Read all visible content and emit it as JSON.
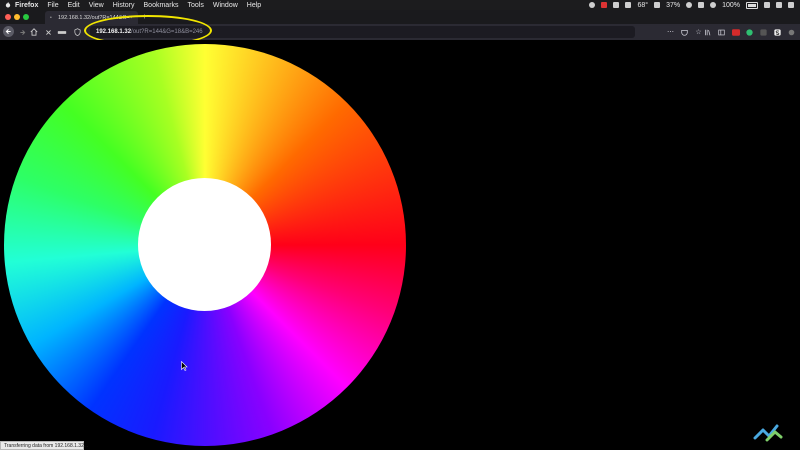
{
  "menubar": {
    "app_name": "Firefox",
    "menus": [
      "File",
      "Edit",
      "View",
      "History",
      "Bookmarks",
      "Tools",
      "Window",
      "Help"
    ],
    "status": {
      "temperature": "68°",
      "cpu_percent": "37%",
      "battery": "100%"
    }
  },
  "tab": {
    "title": "192.168.1.32/out?R=144&G="
  },
  "addressbar": {
    "host": "192.168.1.32",
    "rest": "/out?R=144&G=18&B=246"
  },
  "statusbar": {
    "text": "Transferring data from 192.168.1.32..."
  },
  "content": {
    "color_wheel": "hue-wheel"
  },
  "colors": {
    "highlight": "#f2e600",
    "chrome_dark": "#2b2a33",
    "menubar": "#1c1c1e"
  }
}
